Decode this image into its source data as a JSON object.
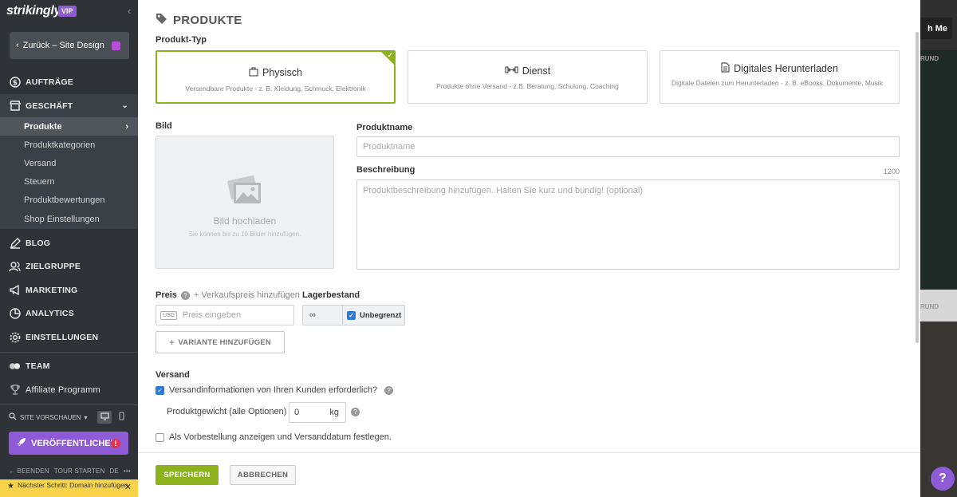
{
  "sidebar": {
    "logo": "strikingly",
    "vip_badge": "VIP",
    "back_label": "Zurück – Site Design",
    "nav": {
      "orders": "AUFTRÄGE",
      "business": "GESCHÄFT",
      "blog": "BLOG",
      "audience": "ZIELGRUPPE",
      "marketing": "MARKETING",
      "analytics": "ANALYTICS",
      "settings": "EINSTELLUNGEN",
      "team": "TEAM",
      "affiliate": "Affiliate Programm"
    },
    "business_sub": [
      "Produkte",
      "Produktkategorien",
      "Versand",
      "Steuern",
      "Produktbewertungen",
      "Shop Einstellungen"
    ],
    "site_preview_label": "SITE VORSCHAUEN",
    "publish_label": "VERÖFFENTLICHEN",
    "publish_alert": "!",
    "tour": {
      "end": "BEENDEN",
      "start": "TOUR STARTEN",
      "lang": "DE",
      "more": "•••"
    },
    "next_step": "Nächster Schritt: Domain hinzufügen"
  },
  "preview": {
    "button_fragment": "h Me",
    "label_1": "RUND",
    "label_2": "RUND",
    "help": "?"
  },
  "panel": {
    "title": "PRODUKTE",
    "product_type_label": "Produkt-Typ",
    "types": [
      {
        "title": "Physisch",
        "desc": "Versendbare Produkte - z. B. Kleidung, Schmuck, Elektronik",
        "selected": true
      },
      {
        "title": "Dienst",
        "desc": "Produkte ohne Versand - z.B. Beratung, Schulung, Coaching",
        "selected": false
      },
      {
        "title": "Digitales Herunterladen",
        "desc": "Digitale Dateien zum Herunterladen - z. B. eBooks, Dokumente, Musik",
        "selected": false
      }
    ],
    "image_label": "Bild",
    "upload_title": "Bild hochladen",
    "upload_sub": "Sie können bis zu 10 Bilder hinzufügen.",
    "name_label": "Produktname",
    "name_placeholder": "Produktname",
    "desc_label": "Beschreibung",
    "desc_counter": "1200",
    "desc_placeholder": "Produktbeschreibung hinzufügen. Halten Sie kurz und bündig! (optional)",
    "price_label": "Preis",
    "price_help": "?",
    "add_sale_price": "+ Verkaufspreis hinzufügen",
    "currency": "USD",
    "price_placeholder": "Preis eingeben",
    "stock_label": "Lagerbestand",
    "stock_value": "∞",
    "unlimited_label": "Unbegrenzt",
    "add_variant": "VARIANTE HINZUFÜGEN",
    "shipping_label": "Versand",
    "shipping_info_label": "Versandinformationen von Ihren Kunden erforderlich?",
    "weight_label": "Produktgewicht (alle Optionen)",
    "weight_value": "0",
    "weight_unit": "kg",
    "preorder_label": "Als Vorbestellung anzeigen und Versanddatum festlegen.",
    "save": "SPEICHERN",
    "cancel": "ABBRECHEN"
  },
  "colors": {
    "accent_green": "#8cb21d",
    "brand_purple": "#8e5ad6",
    "checkbox_blue": "#2d7bd5"
  }
}
